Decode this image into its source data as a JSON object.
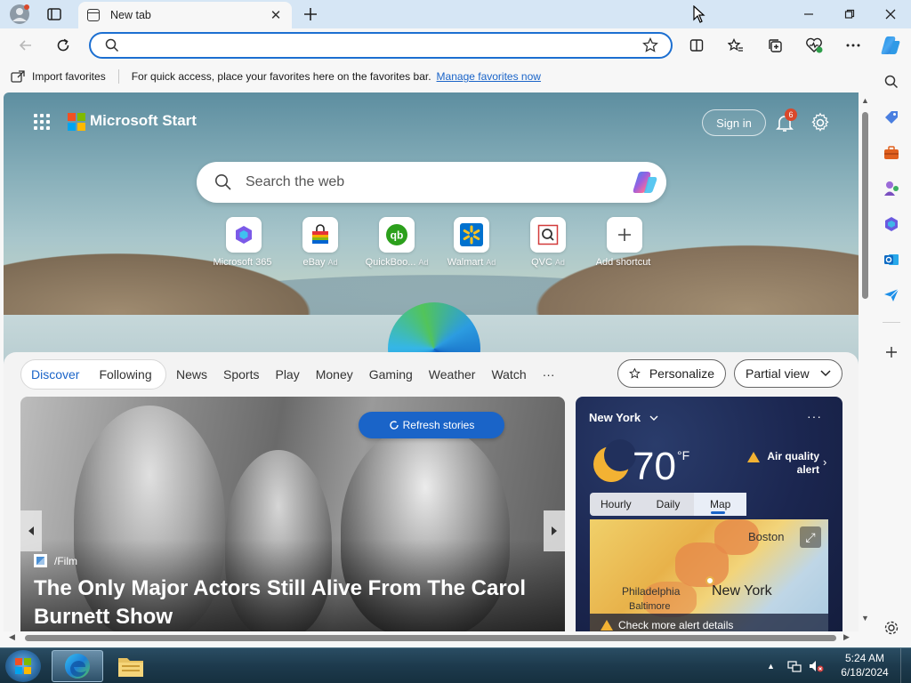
{
  "browser": {
    "tab": {
      "title": "New tab"
    },
    "address_bar": {
      "value": "",
      "placeholder": ""
    },
    "favorites_bar": {
      "import_label": "Import favorites",
      "message": "For quick access, place your favorites here on the favorites bar.",
      "manage_link": "Manage favorites now"
    }
  },
  "page": {
    "brand": "Microsoft Start",
    "sign_in": "Sign in",
    "notification_count": "6",
    "search": {
      "placeholder": "Search the web"
    },
    "shortcuts": [
      {
        "label": "Microsoft 365",
        "ad": ""
      },
      {
        "label": "eBay",
        "ad": "Ad"
      },
      {
        "label": "QuickBoo...",
        "ad": "Ad"
      },
      {
        "label": "Walmart",
        "ad": "Ad"
      },
      {
        "label": "QVC",
        "ad": "Ad"
      },
      {
        "label": "Add shortcut",
        "ad": ""
      }
    ],
    "feed_nav": {
      "toggle": [
        "Discover",
        "Following"
      ],
      "items": [
        "News",
        "Sports",
        "Play",
        "Money",
        "Gaming",
        "Weather",
        "Watch",
        "···"
      ],
      "personalize": "Personalize",
      "view_mode": "Partial view"
    },
    "hero_story": {
      "refresh_label": "Refresh stories",
      "source": "/Film",
      "headline": "The Only Major Actors Still Alive From The Carol Burnett Show"
    },
    "weather": {
      "city": "New York",
      "temperature": "70",
      "unit": "°F",
      "alert": "Air quality alert",
      "tabs": [
        "Hourly",
        "Daily",
        "Map"
      ],
      "selected_tab": "Map",
      "map_labels": [
        "Boston",
        "Philadelphia",
        "Baltimore",
        "New York"
      ],
      "alert_bar": "Check more alert details"
    }
  },
  "taskbar": {
    "time": "5:24 AM",
    "date": "6/18/2024"
  },
  "colors": {
    "accent": "#1a64c8",
    "badge": "#d9482b",
    "weather_bg": "#1b2650",
    "alert": "#f3b233"
  },
  "icons": {
    "titlebar": [
      "profile-icon",
      "workspaces-icon",
      "new-tab-icon",
      "minimize-icon",
      "restore-icon",
      "close-icon"
    ],
    "toolbar": [
      "back-icon",
      "refresh-icon",
      "favorite-star-icon",
      "split-screen-icon",
      "favorites-icon",
      "collections-icon",
      "browser-essentials-icon",
      "more-icon",
      "copilot-icon"
    ],
    "sidebar": [
      "search-icon",
      "shopping-tag-icon",
      "tools-icon",
      "games-icon",
      "microsoft-365-icon",
      "outlook-icon",
      "drop-icon",
      "add-icon",
      "sidebar-settings-icon"
    ]
  }
}
